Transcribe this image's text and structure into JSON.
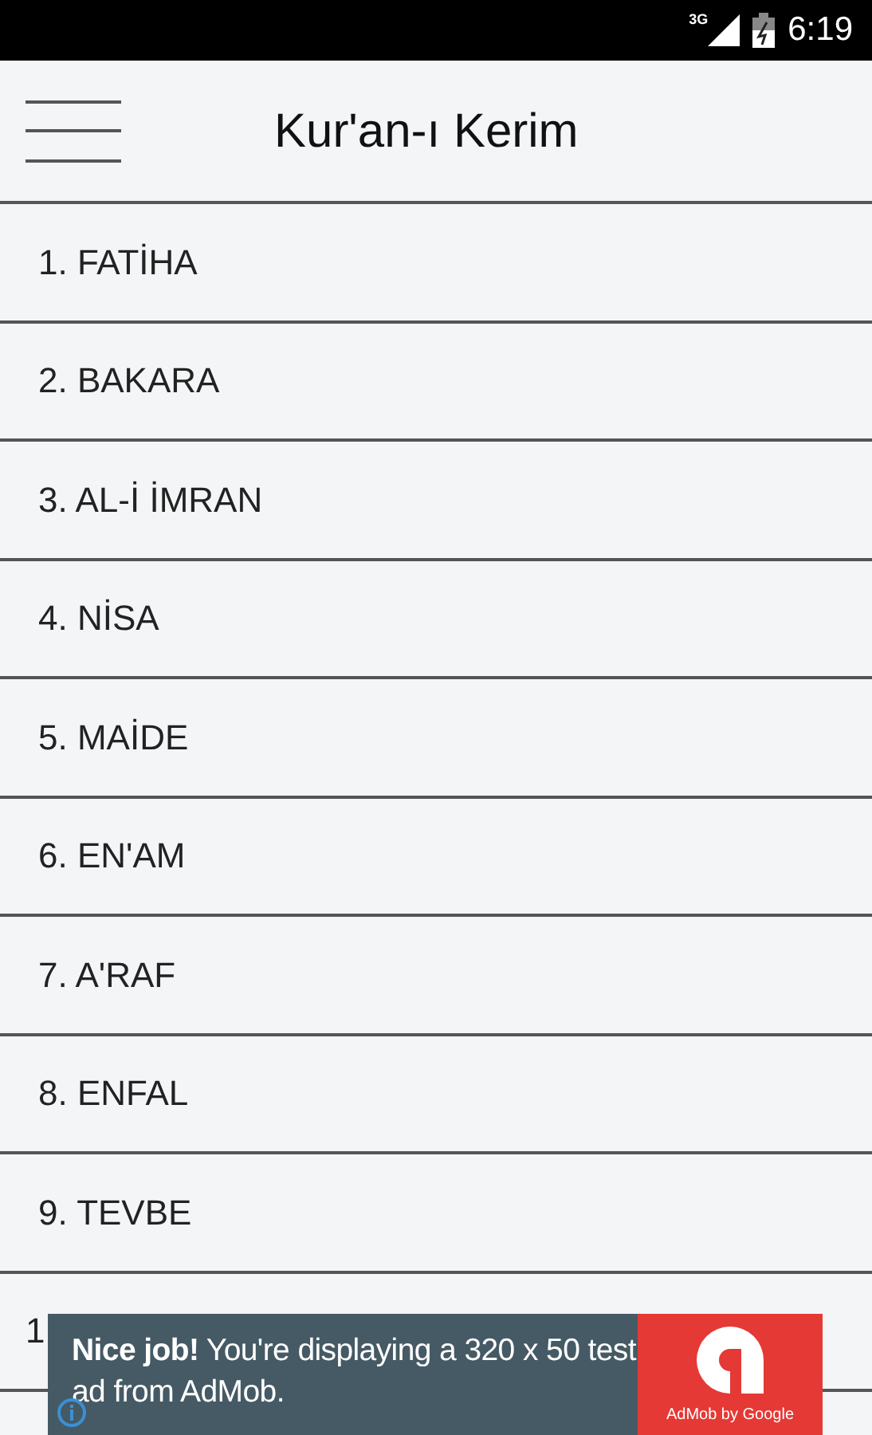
{
  "status_bar": {
    "network": "3G",
    "time": "6:19"
  },
  "header": {
    "title": "Kur'an-ı Kerim"
  },
  "surahs": [
    "1. FATİHA",
    "2. BAKARA",
    "3. AL-İ İMRAN",
    "4. NİSA",
    "5. MAİDE",
    "6. EN'AM",
    "7. A'RAF",
    "8. ENFAL",
    "9. TEVBE",
    "1"
  ],
  "ad": {
    "headline": "**Nice job!** You're displaying a 320 x 50 test ad from AdMob.",
    "brand": "AdMob by Google"
  }
}
